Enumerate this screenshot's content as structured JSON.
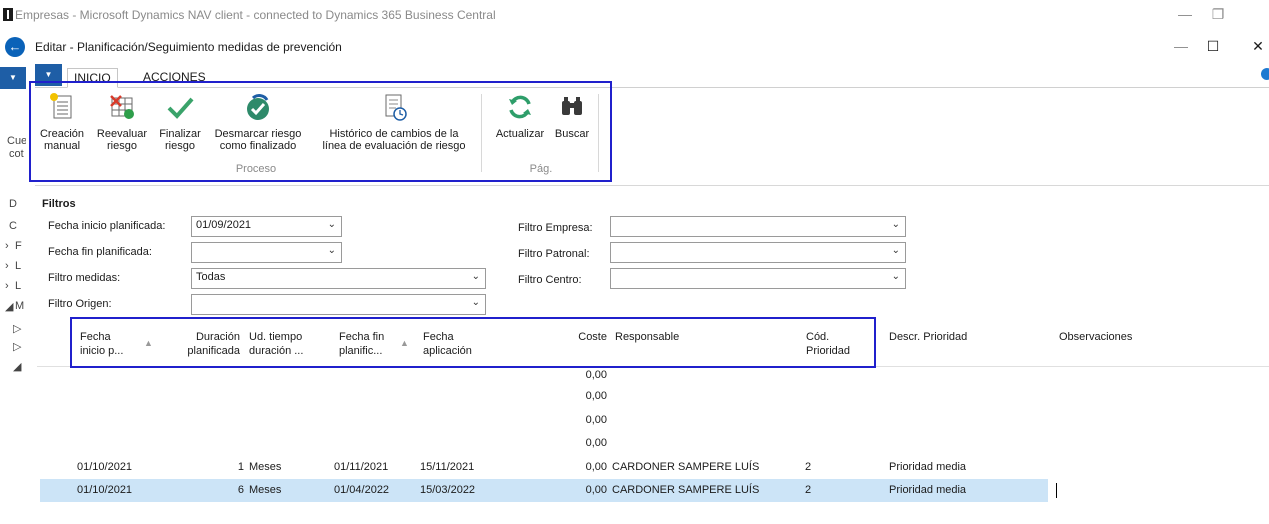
{
  "outer_window": {
    "title": "Empresas - Microsoft Dynamics NAV client - connected to Dynamics 365 Business Central",
    "minimize": "—",
    "restore": "❐"
  },
  "background_fragments": [
    "Cue",
    "cot",
    "D",
    "C",
    "F",
    "L",
    "L",
    "M"
  ],
  "dialog": {
    "title": "Editar - Planificación/Seguimiento medidas de prevención",
    "minimize": "—",
    "maximize": "☐",
    "close": "✕"
  },
  "ribbon_tabs": [
    "INICIO",
    "ACCIONES"
  ],
  "ribbon": {
    "buttons": [
      {
        "line1": "Creación",
        "line2": "manual",
        "icon": "new-document-icon"
      },
      {
        "line1": "Reevaluar",
        "line2": "riesgo",
        "icon": "reevaluate-grid-icon"
      },
      {
        "line1": "Finalizar",
        "line2": "riesgo",
        "icon": "checkmark-icon"
      },
      {
        "line1": "Desmarcar riesgo",
        "line2": "como finalizado",
        "icon": "unmark-check-icon"
      },
      {
        "line1": "Histórico de cambios de la",
        "line2": "línea de evaluación de riesgo",
        "icon": "history-document-icon"
      },
      {
        "line1": "Actualizar",
        "line2": "",
        "icon": "refresh-icon"
      },
      {
        "line1": "Buscar",
        "line2": "",
        "icon": "binoculars-icon"
      }
    ],
    "groups": [
      "Proceso",
      "Pág."
    ]
  },
  "filters": {
    "title": "Filtros",
    "fecha_inicio": {
      "label": "Fecha inicio planificada:",
      "value": "01/09/2021"
    },
    "fecha_fin": {
      "label": "Fecha fin planificada:",
      "value": ""
    },
    "medidas": {
      "label": "Filtro medidas:",
      "value": "Todas"
    },
    "origen": {
      "label": "Filtro Origen:",
      "value": ""
    },
    "empresa": {
      "label": "Filtro Empresa:",
      "value": ""
    },
    "patronal": {
      "label": "Filtro Patronal:",
      "value": ""
    },
    "centro": {
      "label": "Filtro Centro:",
      "value": ""
    }
  },
  "grid": {
    "columns": [
      {
        "line1": "Fecha",
        "line2": "inicio p..."
      },
      {
        "line1": "Duración",
        "line2": "planificada"
      },
      {
        "line1": "Ud. tiempo",
        "line2": "duración ..."
      },
      {
        "line1": "Fecha fin",
        "line2": "planific..."
      },
      {
        "line1": "Fecha",
        "line2": "aplicación"
      },
      {
        "line1": "Coste",
        "line2": ""
      },
      {
        "line1": "Responsable",
        "line2": ""
      },
      {
        "line1": "Cód.",
        "line2": "Prioridad"
      },
      {
        "line1": "Descr. Prioridad",
        "line2": ""
      },
      {
        "line1": "Observaciones",
        "line2": ""
      }
    ],
    "rows": [
      {
        "inicio": "",
        "duracion": "",
        "ud": "",
        "fin": "",
        "aplicacion": "",
        "coste": "0,00",
        "responsable": "",
        "cod": "",
        "descr": "",
        "obs": ""
      },
      {
        "inicio": "",
        "duracion": "",
        "ud": "",
        "fin": "",
        "aplicacion": "",
        "coste": "0,00",
        "responsable": "",
        "cod": "",
        "descr": "",
        "obs": ""
      },
      {
        "inicio": "",
        "duracion": "",
        "ud": "",
        "fin": "",
        "aplicacion": "",
        "coste": "0,00",
        "responsable": "",
        "cod": "",
        "descr": "",
        "obs": ""
      },
      {
        "inicio": "",
        "duracion": "",
        "ud": "",
        "fin": "",
        "aplicacion": "",
        "coste": "0,00",
        "responsable": "",
        "cod": "",
        "descr": "",
        "obs": ""
      },
      {
        "inicio": "01/10/2021",
        "duracion": "1",
        "ud": "Meses",
        "fin": "01/11/2021",
        "aplicacion": "15/11/2021",
        "coste": "0,00",
        "responsable": "CARDONER SAMPERE LUÍS",
        "cod": "2",
        "descr": "Prioridad media",
        "obs": ""
      },
      {
        "inicio": "01/10/2021",
        "duracion": "6",
        "ud": "Meses",
        "fin": "01/04/2022",
        "aplicacion": "15/03/2022",
        "coste": "0,00",
        "responsable": "CARDONER SAMPERE LUÍS",
        "cod": "2",
        "descr": "Prioridad media",
        "obs": ""
      }
    ]
  }
}
